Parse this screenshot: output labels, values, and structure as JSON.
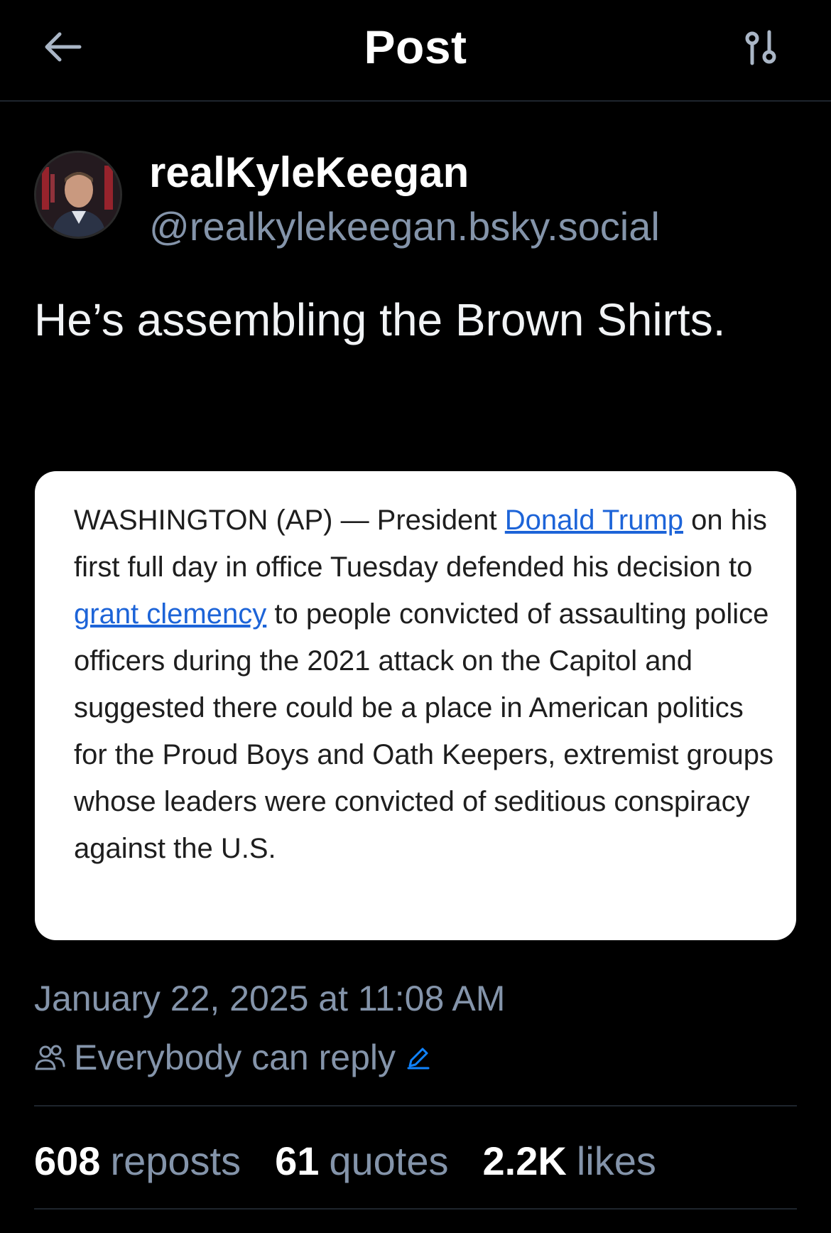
{
  "header": {
    "title": "Post",
    "back_icon": "arrow-left-icon",
    "filter_icon": "sliders-icon"
  },
  "author": {
    "display_name": "realKyleKeegan",
    "handle": "@realkylekeegan.bsky.social"
  },
  "post": {
    "text": "He’s assembling the Brown Shirts."
  },
  "embed": {
    "text_1": "WASHINGTON (AP) — President ",
    "link_1": "Donald Trump",
    "text_2": " on his first full day in office Tuesday defended his decision to ",
    "link_2": "grant clemency",
    "text_3": " to people convicted of assaulting police officers during the 2021 attack on the Capitol and suggested there could be a place in American politics for the Proud Boys and Oath Keepers, extremist groups whose leaders were convicted of seditious conspiracy against the U.S."
  },
  "meta": {
    "timestamp": "January 22, 2025 at 11:08 AM",
    "reply_setting": "Everybody can reply"
  },
  "stats": {
    "reposts_count": "608",
    "reposts_label": "reposts",
    "quotes_count": "61",
    "quotes_label": "quotes",
    "likes_count": "2.2K",
    "likes_label": "likes"
  },
  "colors": {
    "background": "#000000",
    "muted_text": "#8494aa",
    "link": "#1d64d8",
    "accent_blue": "#1083fe",
    "divider": "#1e252d"
  }
}
